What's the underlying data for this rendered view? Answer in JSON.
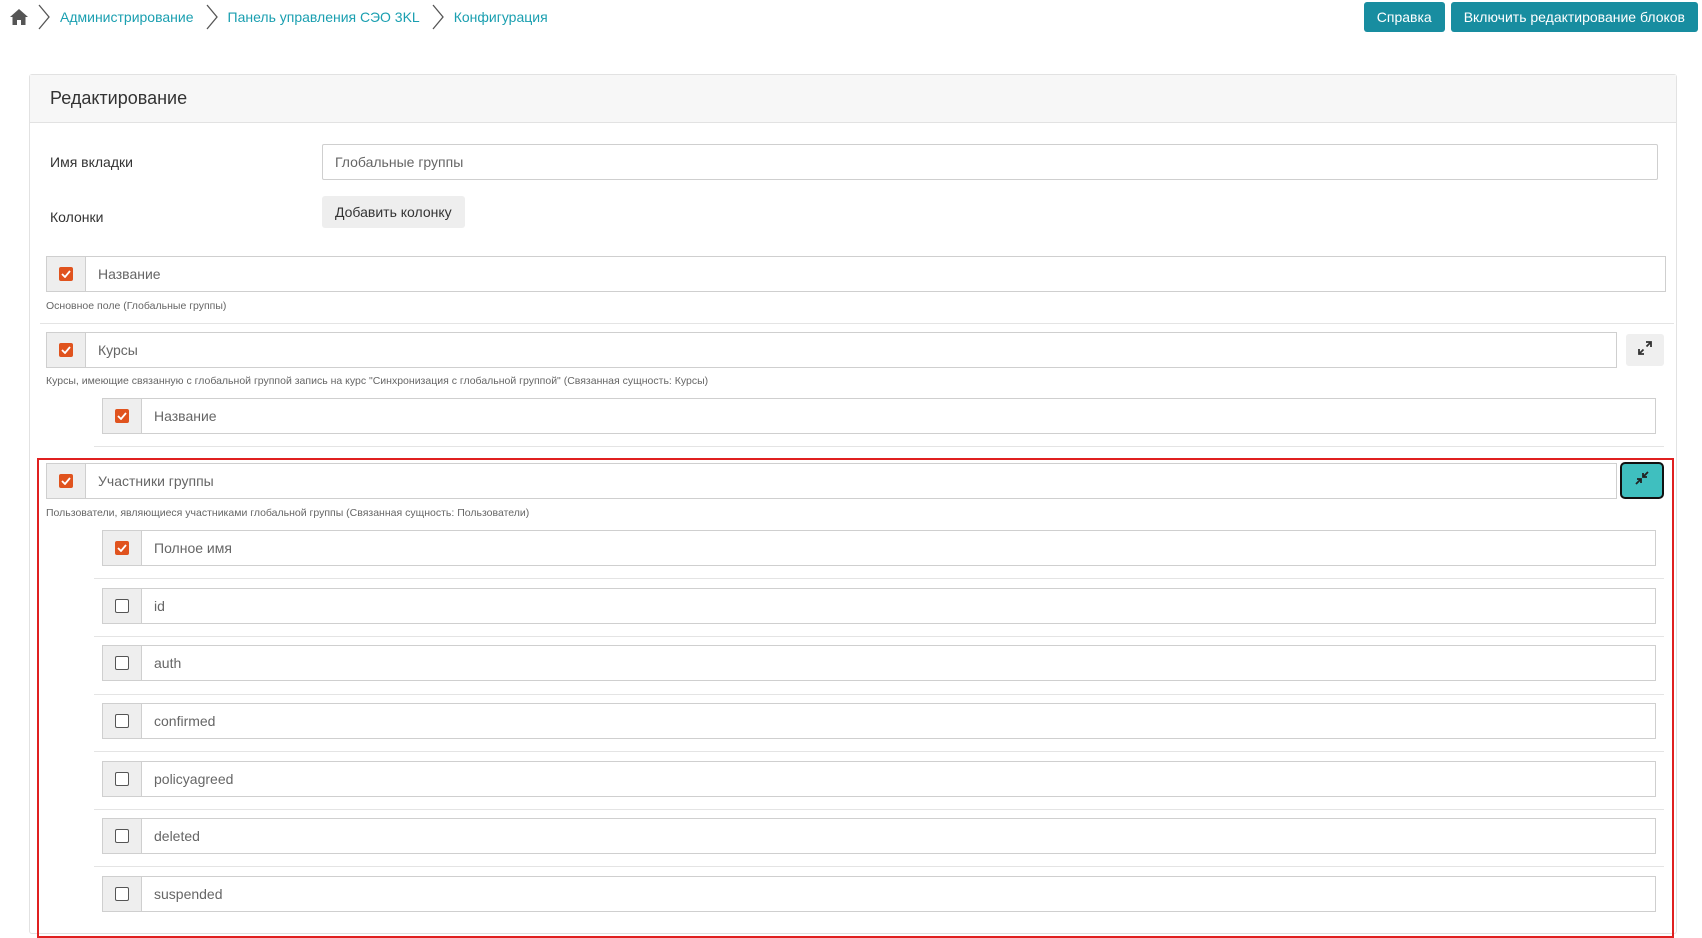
{
  "breadcrumb": {
    "items": [
      {
        "label": "Администрирование"
      },
      {
        "label": "Панель управления СЭО 3KL"
      },
      {
        "label": "Конфигурация"
      }
    ]
  },
  "top_actions": {
    "help_label": "Справка",
    "edit_blocks_label": "Включить редактирование блоков"
  },
  "card": {
    "title": "Редактирование"
  },
  "form": {
    "tab_name_label": "Имя вкладки",
    "tab_name_value": "Глобальные группы",
    "columns_label": "Колонки",
    "add_column_label": "Добавить колонку"
  },
  "columns": {
    "name": {
      "label": "Название",
      "checked": true,
      "description": "Основное поле (Глобальные группы)"
    },
    "courses": {
      "label": "Курсы",
      "checked": true,
      "description": "Курсы, имеющие связанную с глобальной группой запись на курс \"Синхронизация с глобальной группой\" (Связанная сущность: Курсы)",
      "children": [
        {
          "label": "Название",
          "checked": true
        }
      ]
    },
    "members": {
      "label": "Участники группы",
      "checked": true,
      "description": "Пользователи, являющиеся участниками глобальной группы (Связанная сущность: Пользователи)",
      "children": [
        {
          "label": "Полное имя",
          "checked": true
        },
        {
          "label": "id",
          "checked": false
        },
        {
          "label": "auth",
          "checked": false
        },
        {
          "label": "confirmed",
          "checked": false
        },
        {
          "label": "policyagreed",
          "checked": false
        },
        {
          "label": "deleted",
          "checked": false
        },
        {
          "label": "suspended",
          "checked": false
        }
      ]
    }
  },
  "icons": {
    "home": "home-icon",
    "separator": "chevron-right-icon",
    "checked": "checkbox-checked-icon",
    "unchecked": "checkbox-unchecked-icon",
    "expand": "expand-icon",
    "collapse": "collapse-icon"
  },
  "colors": {
    "accent": "#188da0",
    "link": "#1a9fb0",
    "checkbox": "#e0531e",
    "collapse_button": "#3fbfbf",
    "highlight": "#e02020"
  }
}
